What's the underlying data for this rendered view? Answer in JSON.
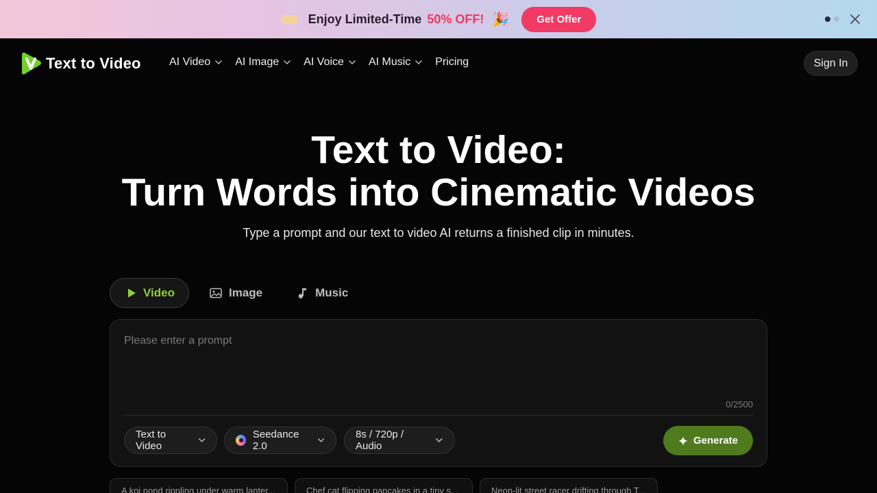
{
  "promo": {
    "text": "Enjoy Limited-Time",
    "highlight": "50% OFF!",
    "button": "Get Offer",
    "accent": "#ef3a66"
  },
  "nav": {
    "logo_text": "Text to Video",
    "items": [
      {
        "label": "AI Video",
        "has_dropdown": true
      },
      {
        "label": "AI Image",
        "has_dropdown": true
      },
      {
        "label": "AI Voice",
        "has_dropdown": true
      },
      {
        "label": "AI Music",
        "has_dropdown": true
      },
      {
        "label": "Pricing",
        "has_dropdown": false
      }
    ],
    "sign_in": "Sign In"
  },
  "hero": {
    "title_line1": "Text to Video:",
    "title_line2": "Turn Words into Cinematic Videos",
    "subtitle": "Type a prompt and our text to video AI returns a finished clip in minutes."
  },
  "tabs": [
    {
      "label": "Video",
      "icon": "play-icon",
      "active": true
    },
    {
      "label": "Image",
      "icon": "image-icon",
      "active": false
    },
    {
      "label": "Music",
      "icon": "music-note-icon",
      "active": false
    }
  ],
  "composer": {
    "placeholder": "Please enter a prompt",
    "value": "",
    "counter": "0/2500",
    "mode": "Text to Video",
    "model": "Seedance 2.0",
    "spec": "8s / 720p / Audio",
    "generate": "Generate"
  },
  "examples": [
    "A koi pond rippling under warm lanter...",
    "Chef cat flipping pancakes in a tiny s...",
    "Neon-lit street racer drifting through T..."
  ],
  "colors": {
    "accent_green": "#8fd13a",
    "generate_bg": "#4f7a1e",
    "background": "#050505"
  }
}
